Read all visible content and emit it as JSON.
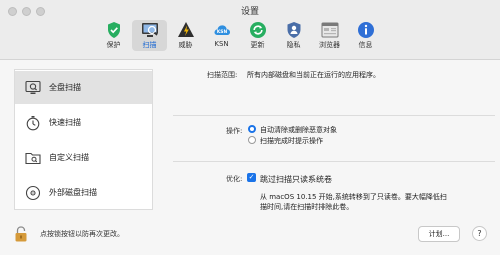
{
  "window": {
    "title": "设置"
  },
  "toolbar": {
    "items": [
      {
        "id": "protect",
        "label": "保护",
        "icon": "shield-check-icon"
      },
      {
        "id": "scan",
        "label": "扫描",
        "icon": "scan-monitor-icon",
        "active": true
      },
      {
        "id": "threats",
        "label": "威胁",
        "icon": "warning-bolt-icon"
      },
      {
        "id": "ksn",
        "label": "KSN",
        "icon": "ksn-cloud-icon"
      },
      {
        "id": "update",
        "label": "更新",
        "icon": "refresh-icon"
      },
      {
        "id": "privacy",
        "label": "隐私",
        "icon": "privacy-user-icon"
      },
      {
        "id": "browser",
        "label": "浏览器",
        "icon": "browser-window-icon"
      },
      {
        "id": "info",
        "label": "信息",
        "icon": "info-icon"
      }
    ]
  },
  "sidebar": {
    "items": [
      {
        "id": "full",
        "label": "全盘扫描",
        "icon": "full-scan-icon",
        "active": true
      },
      {
        "id": "quick",
        "label": "快速扫描",
        "icon": "stopwatch-icon"
      },
      {
        "id": "custom",
        "label": "自定义扫描",
        "icon": "folder-icon"
      },
      {
        "id": "external",
        "label": "外部磁盘扫描",
        "icon": "external-disk-icon"
      }
    ]
  },
  "settings": {
    "scope_label": "扫描范围:",
    "scope_value": "所有内部磁盘和当前正在运行的应用程序。",
    "action_label": "操作:",
    "action_option1": "自动清除或删除恶意对象",
    "action_option2": "扫描完成时提示操作",
    "optimize_label": "优化:",
    "optimize_option": "跳过扫描只读系统卷",
    "optimize_note_line1": "从 macOS 10.15 开始,系统转移到了只读卷。要大幅降低扫",
    "optimize_note_line2": "描时间,请在扫描时排除此卷。"
  },
  "footer": {
    "lock_text": "点按锁按钮以防再次更改。",
    "schedule_button": "计划...",
    "help_button": "?"
  },
  "colors": {
    "accent": "#1a73e8",
    "green": "#27ae60",
    "yellow": "#f2b705"
  }
}
